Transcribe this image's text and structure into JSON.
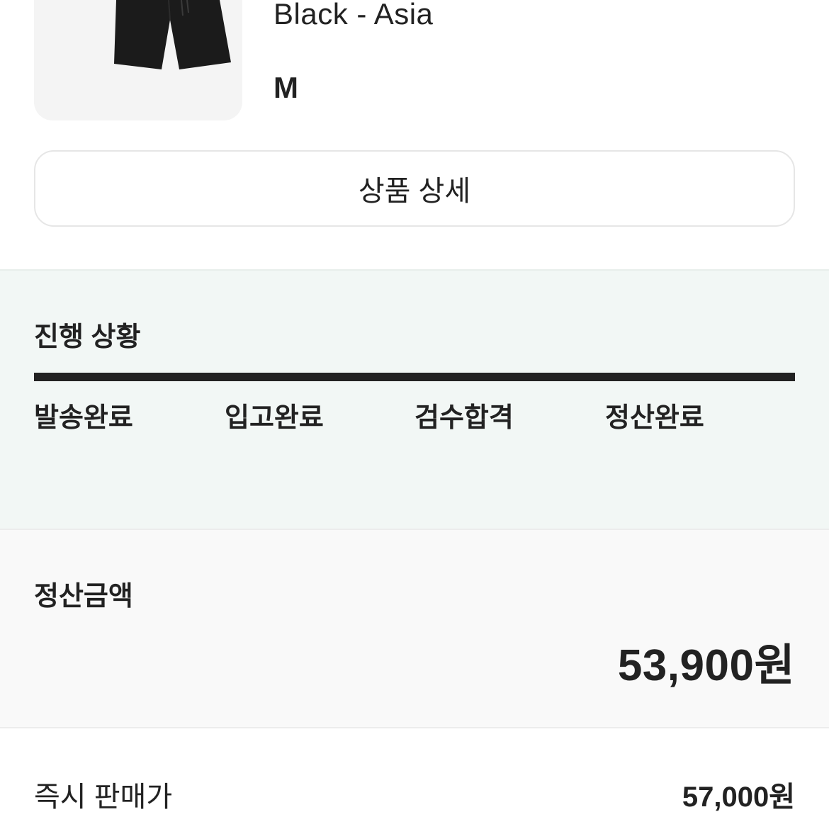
{
  "product": {
    "image_icon": "shorts-icon",
    "variant_line": "Black - Asia",
    "size": "M",
    "detail_button_label": "상품 상세"
  },
  "progress": {
    "title": "진행 상황",
    "completion_fraction": 1.0,
    "steps": [
      {
        "label": "발송완료"
      },
      {
        "label": "입고완료"
      },
      {
        "label": "검수합격"
      },
      {
        "label": "정산완료"
      }
    ]
  },
  "settlement": {
    "title": "정산금액",
    "amount": "53,900원"
  },
  "instant_sale": {
    "label": "즉시 판매가",
    "value": "57,000원"
  },
  "colors": {
    "progress_bg": "#f2f7f5",
    "settlement_bg": "#f9f9f9",
    "text": "#222222",
    "bar": "#222222"
  }
}
